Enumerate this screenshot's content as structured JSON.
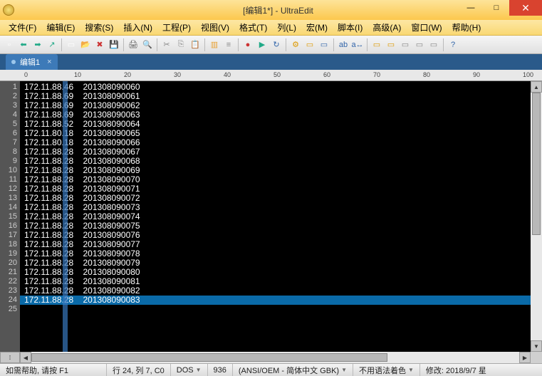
{
  "title": "[编辑1*] - UltraEdit",
  "window_buttons": {
    "min": "—",
    "max": "□",
    "close": "✕"
  },
  "menus": [
    "文件(F)",
    "编辑(E)",
    "搜索(S)",
    "插入(N)",
    "工程(P)",
    "视图(V)",
    "格式(T)",
    "列(L)",
    "宏(M)",
    "脚本(I)",
    "高级(A)",
    "窗口(W)",
    "帮助(H)"
  ],
  "tab": {
    "name": "编辑1",
    "close": "×"
  },
  "ruler_ticks": [
    "0",
    "10",
    "20",
    "30",
    "40",
    "50",
    "60",
    "70",
    "80",
    "90",
    "100"
  ],
  "lines": [
    {
      "n": 1,
      "ip": "172.11.88.46",
      "id": "201308090060"
    },
    {
      "n": 2,
      "ip": "172.11.88.69",
      "id": "201308090061"
    },
    {
      "n": 3,
      "ip": "172.11.88.69",
      "id": "201308090062"
    },
    {
      "n": 4,
      "ip": "172.11.88.69",
      "id": "201308090063"
    },
    {
      "n": 5,
      "ip": "172.11.88.52",
      "id": "201308090064"
    },
    {
      "n": 6,
      "ip": "172.11.80.18",
      "id": "201308090065"
    },
    {
      "n": 7,
      "ip": "172.11.80.18",
      "id": "201308090066"
    },
    {
      "n": 8,
      "ip": "172.11.88.28",
      "id": "201308090067"
    },
    {
      "n": 9,
      "ip": "172.11.88.28",
      "id": "201308090068"
    },
    {
      "n": 10,
      "ip": "172.11.88.28",
      "id": "201308090069"
    },
    {
      "n": 11,
      "ip": "172.11.88.28",
      "id": "201308090070"
    },
    {
      "n": 12,
      "ip": "172.11.88.28",
      "id": "201308090071"
    },
    {
      "n": 13,
      "ip": "172.11.88.28",
      "id": "201308090072"
    },
    {
      "n": 14,
      "ip": "172.11.88.28",
      "id": "201308090073"
    },
    {
      "n": 15,
      "ip": "172.11.88.28",
      "id": "201308090074"
    },
    {
      "n": 16,
      "ip": "172.11.88.28",
      "id": "201308090075"
    },
    {
      "n": 17,
      "ip": "172.11.88.28",
      "id": "201308090076"
    },
    {
      "n": 18,
      "ip": "172.11.88.28",
      "id": "201308090077"
    },
    {
      "n": 19,
      "ip": "172.11.88.28",
      "id": "201308090078"
    },
    {
      "n": 20,
      "ip": "172.11.88.28",
      "id": "201308090079"
    },
    {
      "n": 21,
      "ip": "172.11.88.28",
      "id": "201308090080"
    },
    {
      "n": 22,
      "ip": "172.11.88.28",
      "id": "201308090081"
    },
    {
      "n": 23,
      "ip": "172.11.88.28",
      "id": "201308090082"
    },
    {
      "n": 24,
      "ip": "172.11.88.28",
      "id": "201308090083"
    }
  ],
  "empty_line_num": 25,
  "current_line": 24,
  "status": {
    "help": "如需帮助, 请按 F1",
    "pos": "行 24, 列 7, C0",
    "mode": "DOS",
    "codepage": "936",
    "encoding": "(ANSI/OEM - 简体中文 GBK)",
    "syntax": "不用语法着色",
    "modified": "修改: 2018/9/7 星"
  },
  "toolbar_icons": [
    {
      "name": "new-icon",
      "g": "▫",
      "c": "#fff"
    },
    {
      "name": "back-icon",
      "g": "⬅",
      "c": "#2a8"
    },
    {
      "name": "fwd-icon",
      "g": "➡",
      "c": "#2a8"
    },
    {
      "name": "up-icon",
      "g": "↗",
      "c": "#2a8"
    },
    {
      "name": "sep"
    },
    {
      "name": "new-file-icon",
      "g": "▭",
      "c": "#fff"
    },
    {
      "name": "open-icon",
      "g": "📂",
      "c": "#d90"
    },
    {
      "name": "close-icon",
      "g": "✖",
      "c": "#c33"
    },
    {
      "name": "save-icon",
      "g": "💾",
      "c": "#36a"
    },
    {
      "name": "sep"
    },
    {
      "name": "print-icon",
      "g": "🖨",
      "c": "#555"
    },
    {
      "name": "preview-icon",
      "g": "🔍",
      "c": "#555"
    },
    {
      "name": "sep"
    },
    {
      "name": "cut-icon",
      "g": "✂",
      "c": "#888"
    },
    {
      "name": "copy-icon",
      "g": "⎘",
      "c": "#888"
    },
    {
      "name": "paste-icon",
      "g": "📋",
      "c": "#888"
    },
    {
      "name": "sep"
    },
    {
      "name": "view1-icon",
      "g": "▥",
      "c": "#e8a030"
    },
    {
      "name": "view2-icon",
      "g": "≡",
      "c": "#888"
    },
    {
      "name": "sep"
    },
    {
      "name": "rec-icon",
      "g": "●",
      "c": "#c33"
    },
    {
      "name": "play-icon",
      "g": "▶",
      "c": "#2a8"
    },
    {
      "name": "stop-icon",
      "g": "↻",
      "c": "#36a"
    },
    {
      "name": "sep"
    },
    {
      "name": "tool1-icon",
      "g": "⚙",
      "c": "#d90"
    },
    {
      "name": "tool2-icon",
      "g": "▭",
      "c": "#d90"
    },
    {
      "name": "tool3-icon",
      "g": "▭",
      "c": "#36a"
    },
    {
      "name": "sep"
    },
    {
      "name": "find-icon",
      "g": "ab",
      "c": "#36a"
    },
    {
      "name": "replace-icon",
      "g": "a↔",
      "c": "#36a"
    },
    {
      "name": "sep"
    },
    {
      "name": "t4-icon",
      "g": "▭",
      "c": "#d90"
    },
    {
      "name": "t5-icon",
      "g": "▭",
      "c": "#d90"
    },
    {
      "name": "t6-icon",
      "g": "▭",
      "c": "#888"
    },
    {
      "name": "t7-icon",
      "g": "▭",
      "c": "#888"
    },
    {
      "name": "t8-icon",
      "g": "▭",
      "c": "#888"
    },
    {
      "name": "sep"
    },
    {
      "name": "help-icon",
      "g": "?",
      "c": "#36a"
    }
  ]
}
